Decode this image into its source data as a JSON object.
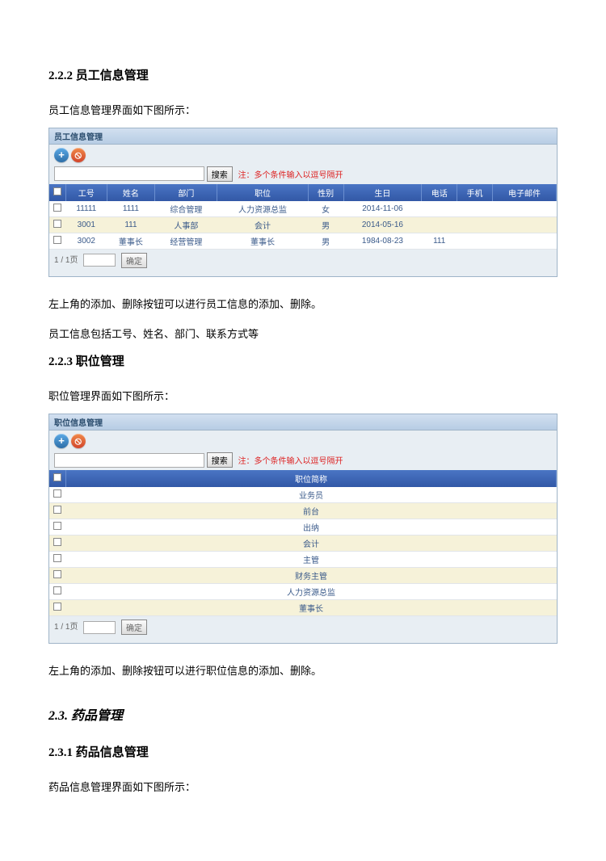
{
  "sec1": {
    "heading": "2.2.2 员工信息管理",
    "intro": "员工信息管理界面如下图所示：",
    "panel_title": "员工信息管理",
    "search_btn": "搜索",
    "hint": "注：多个条件输入以逗号隔开",
    "cols": [
      "",
      "工号",
      "姓名",
      "部门",
      "职位",
      "性别",
      "生日",
      "电话",
      "手机",
      "电子邮件"
    ],
    "rows": [
      [
        "11111",
        "1111",
        "综合管理",
        "人力资源总监",
        "女",
        "2014-11-06",
        "",
        "",
        ""
      ],
      [
        "3001",
        "111",
        "人事部",
        "会计",
        "男",
        "2014-05-16",
        "",
        "",
        ""
      ],
      [
        "3002",
        "董事长",
        "经营管理",
        "董事长",
        "男",
        "1984-08-23",
        "111",
        "",
        ""
      ]
    ],
    "pager_label": "1 / 1页",
    "pager_btn": "确定",
    "desc1": "左上角的添加、删除按钮可以进行员工信息的添加、删除。",
    "desc2": "员工信息包括工号、姓名、部门、联系方式等"
  },
  "sec2": {
    "heading": "2.2.3 职位管理",
    "intro": "职位管理界面如下图所示：",
    "panel_title": "职位信息管理",
    "search_btn": "搜索",
    "hint": "注：多个条件输入以逗号隔开",
    "col": "职位简称",
    "rows": [
      "业务员",
      "前台",
      "出纳",
      "会计",
      "主管",
      "财务主管",
      "人力资源总监",
      "董事长"
    ],
    "pager_label": "1 / 1页",
    "pager_btn": "确定",
    "desc1": "左上角的添加、删除按钮可以进行职位信息的添加、删除。"
  },
  "sec3": {
    "heading_italic": "2.3. 药品管理",
    "heading": "2.3.1 药品信息管理",
    "intro": "药品信息管理界面如下图所示："
  }
}
